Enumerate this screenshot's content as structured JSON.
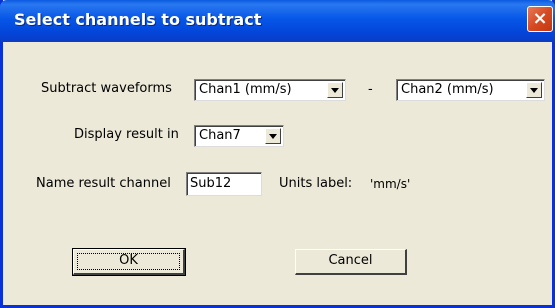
{
  "window": {
    "title": "Select channels to subtract",
    "close_glyph": "×"
  },
  "form": {
    "subtract_label": "Subtract waveforms",
    "channel_a": "Chan1 (mm/s)",
    "minus_sign": "-",
    "channel_b": "Chan2 (mm/s)",
    "display_label": "Display result in",
    "display_channel": "Chan7",
    "name_label": "Name result channel",
    "name_value": "Sub12",
    "units_label": "Units label:",
    "units_value": "'mm/s'"
  },
  "buttons": {
    "ok": "OK",
    "cancel": "Cancel"
  },
  "icons": {
    "close": "close-icon",
    "dropdown": "chevron-down-icon"
  },
  "colors": {
    "title_bar": "#0656e8",
    "dialog_face": "#ece9d8",
    "close_button": "#d64a22"
  }
}
